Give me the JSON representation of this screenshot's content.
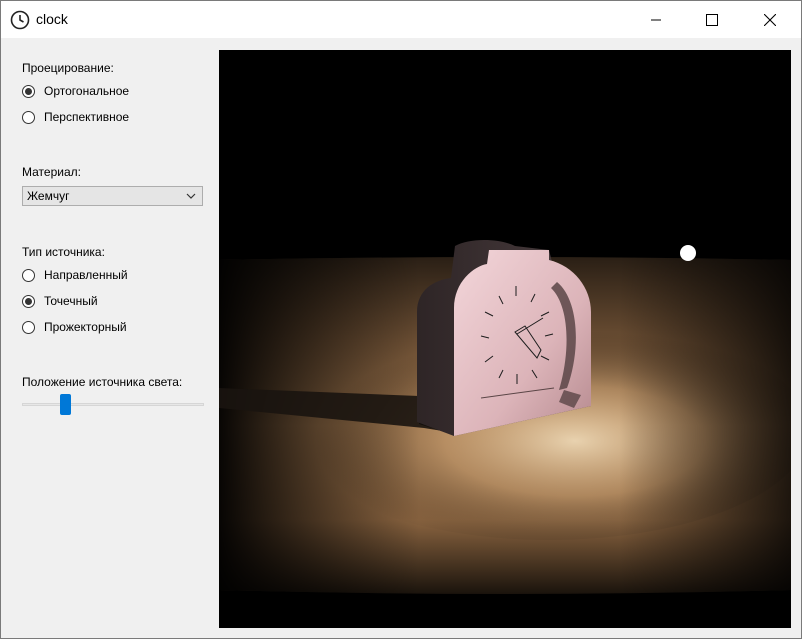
{
  "window": {
    "title": "clock"
  },
  "panel": {
    "projection_label": "Проецирование:",
    "projection_options": [
      "Ортогональное",
      "Перспективное"
    ],
    "projection_selected": 0,
    "material_label": "Материал:",
    "material_value": "Жемчуг",
    "source_type_label": "Тип источника:",
    "source_type_options": [
      "Направленный",
      "Точечный",
      "Прожекторный"
    ],
    "source_type_selected": 1,
    "light_position_label": "Положение источника света:",
    "light_position_value": 0.22
  },
  "colors": {
    "accent": "#0078d7",
    "clock_body": "#e8c3c8",
    "floor": "#b7895c"
  }
}
